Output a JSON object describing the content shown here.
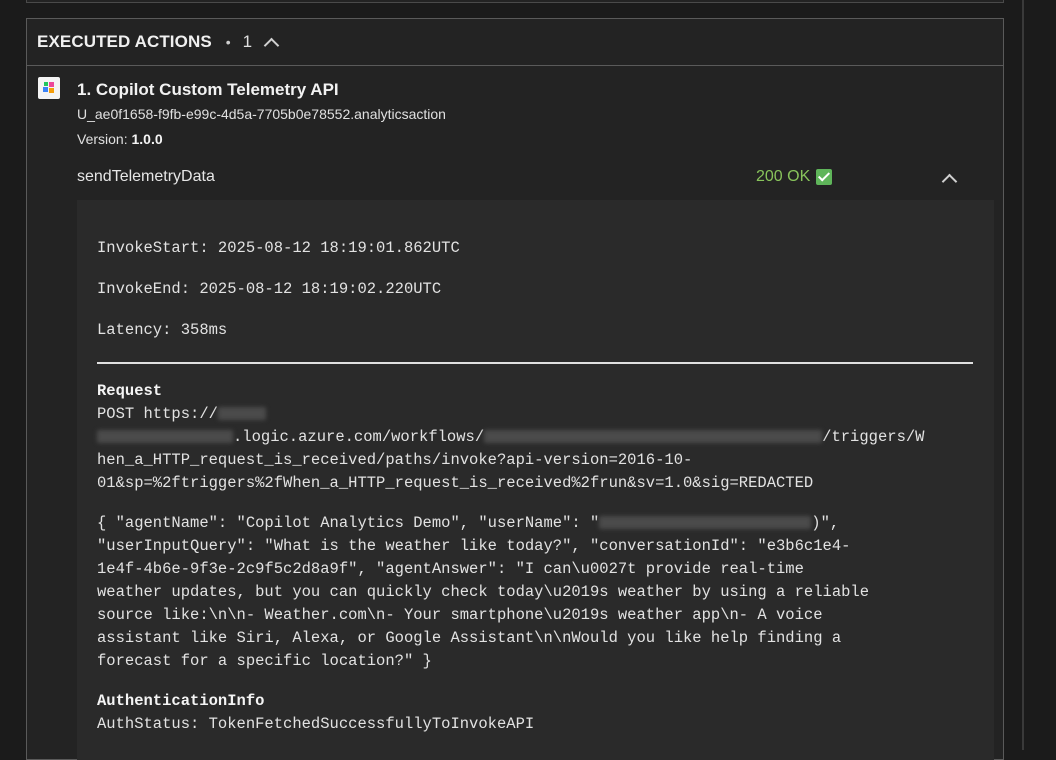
{
  "panel": {
    "title": "EXECUTED ACTIONS",
    "separator": "•",
    "count": "1"
  },
  "action": {
    "title": "1. Copilot Custom Telemetry API",
    "id": "U_ae0f1658-f9fb-e99c-4d5a-7705b0e78552.analyticsaction",
    "version_label": "Version:",
    "version_value": "1.0.0",
    "operation": "sendTelemetryData",
    "status": "200 OK"
  },
  "details": {
    "invoke_start": "InvokeStart: 2025-08-12 18:19:01.862UTC",
    "invoke_end": "InvokeEnd: 2025-08-12 18:19:02.220UTC",
    "latency": "Latency: 358ms",
    "request_title": "Request",
    "request_line1": "POST https://",
    "request_line2": ".logic.azure.com/workflows/",
    "request_line2b": "/triggers/W",
    "request_line3": "hen_a_HTTP_request_is_received/paths/invoke?api-version=2016-10-",
    "request_line4": "01&sp=%2ftriggers%2fWhen_a_HTTP_request_is_received%2frun&sv=1.0&sig=REDACTED",
    "body_line1a": "{ \"agentName\": \"Copilot Analytics Demo\", \"userName\": \"",
    "body_line1b": ")\",",
    "body_line2": "\"userInputQuery\": \"What is the weather like today?\", \"conversationId\": \"e3b6c1e4-",
    "body_line3": "1e4f-4b6e-9f3e-2c9f5c2d8a9f\", \"agentAnswer\": \"I can\\u0027t provide real-time",
    "body_line4": "weather updates, but you can quickly check today\\u2019s weather by using a reliable",
    "body_line5": "source like:\\n\\n- Weather.com\\n- Your smartphone\\u2019s weather app\\n- A voice",
    "body_line6": "assistant like Siri, Alexa, or Google Assistant\\n\\nWould you like help finding a",
    "body_line7": "forecast for a specific location?\" }",
    "auth_title": "AuthenticationInfo",
    "auth_status": "AuthStatus: TokenFetchedSuccessfullyToInvokeAPI"
  }
}
